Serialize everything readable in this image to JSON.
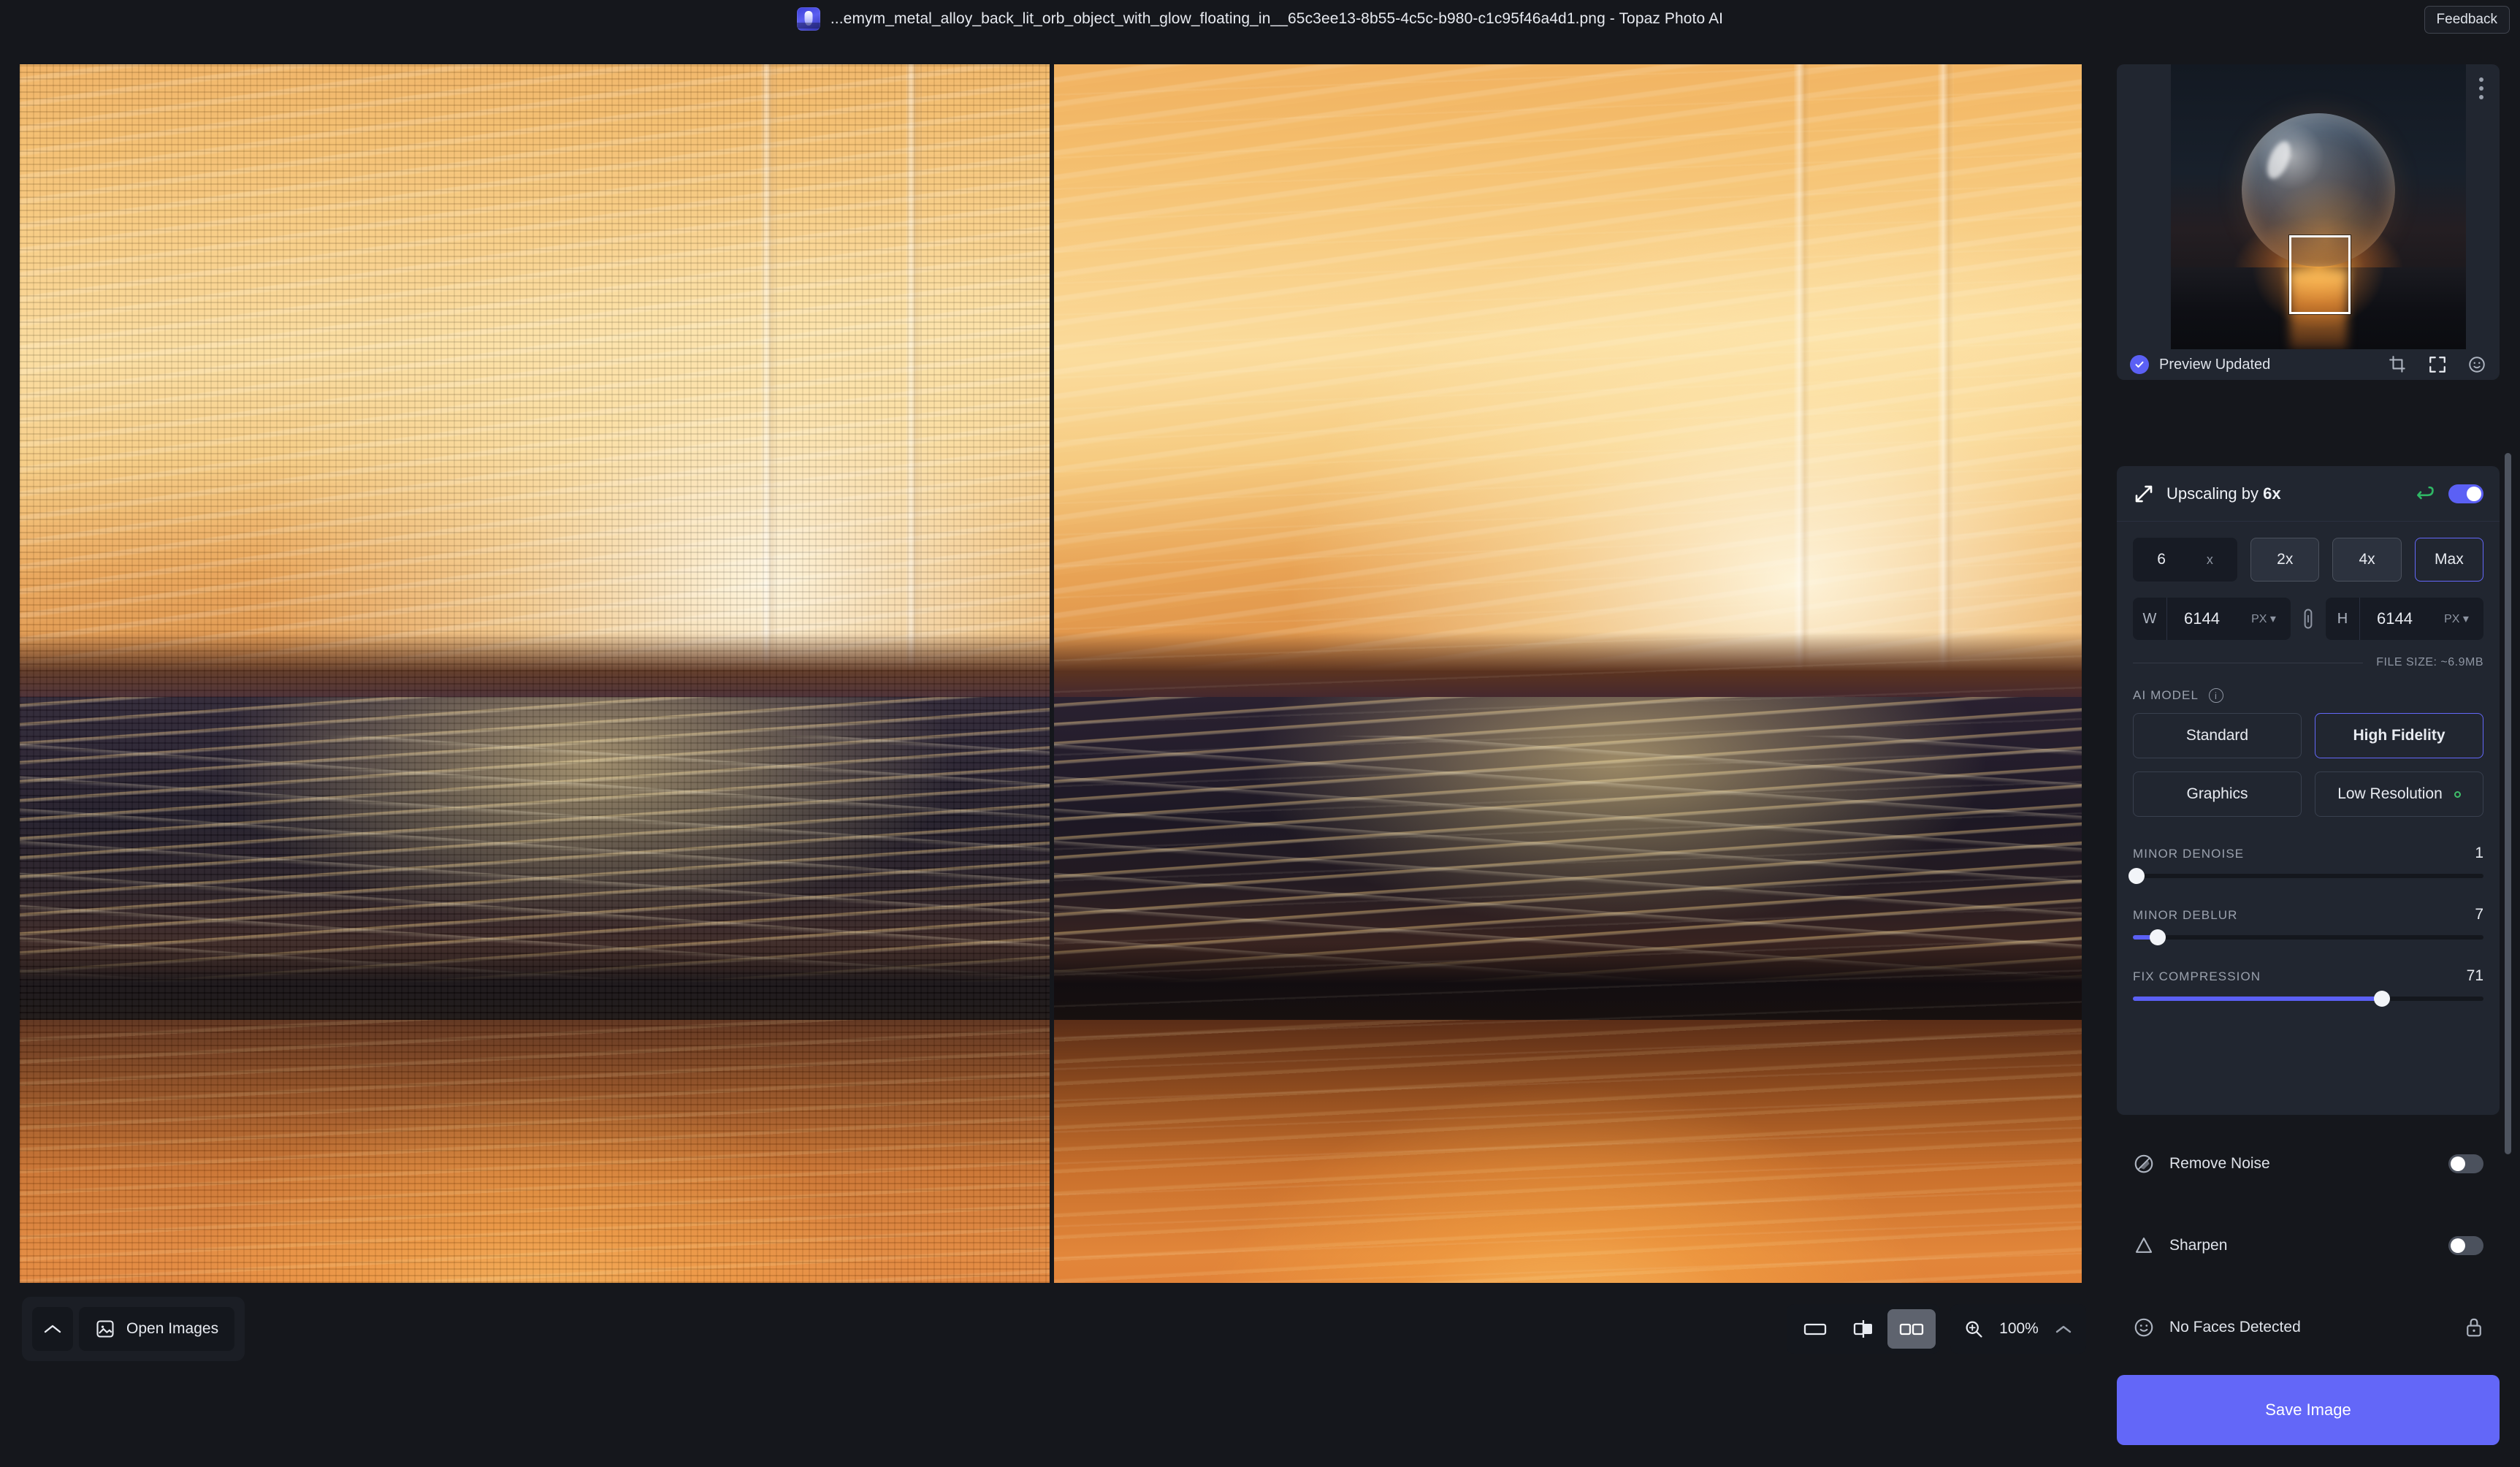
{
  "window": {
    "title": "...emym_metal_alloy_back_lit_orb_object_with_glow_floating_in__65c3ee13-8b55-4c5c-b980-c1c95f46a4d1.png - Topaz Photo AI",
    "feedback_label": "Feedback",
    "logo_icon": "topaz-photo-ai-logo"
  },
  "stage": {
    "before_pane_name": "original-image-pane",
    "after_pane_name": "processed-image-pane"
  },
  "bottom_bar": {
    "collapse_icon": "chevron-up-icon",
    "open_images_label": "Open Images",
    "open_images_icon": "image-icon",
    "view_modes": [
      {
        "name": "single-view",
        "icon": "rectangle-icon",
        "active": false
      },
      {
        "name": "split-view",
        "icon": "split-compare-icon",
        "active": false
      },
      {
        "name": "side-by-side-view",
        "icon": "two-panes-icon",
        "active": true
      }
    ],
    "zoom_icon": "magnifier-plus-icon",
    "zoom_value": "100%",
    "zoom_expand_icon": "chevron-up-icon"
  },
  "sidebar": {
    "preview": {
      "kebab_icon": "more-options-icon",
      "status_label": "Preview Updated",
      "status_icon": "check-circle-icon",
      "actions": [
        {
          "name": "crop-tool",
          "icon": "crop-icon"
        },
        {
          "name": "fullscreen-tool",
          "icon": "expand-icon"
        },
        {
          "name": "face-tool",
          "icon": "smiley-icon"
        }
      ]
    },
    "upscale": {
      "icon": "resize-arrows-icon",
      "title_prefix": "Upscaling by ",
      "title_value": "6x",
      "reset_icon": "undo-arrow-icon",
      "enabled": true,
      "scale_value": "6",
      "scale_unit": "x",
      "scale_presets": [
        {
          "label": "2x",
          "selected": false
        },
        {
          "label": "4x",
          "selected": false
        },
        {
          "label": "Max",
          "selected": true
        }
      ],
      "width_key": "W",
      "width_value": "6144",
      "width_unit": "PX",
      "link_icon": "link-icon",
      "height_key": "H",
      "height_value": "6144",
      "height_unit": "PX",
      "file_size": "FILE SIZE: ~6.9MB",
      "ai_model_label": "AI MODEL",
      "ai_model_info_icon": "info-icon",
      "models": [
        {
          "label": "Standard",
          "selected": false,
          "dot": false
        },
        {
          "label": "High Fidelity",
          "selected": true,
          "dot": false
        },
        {
          "label": "Graphics",
          "selected": false,
          "dot": false
        },
        {
          "label": "Low Resolution",
          "selected": false,
          "dot": true
        }
      ],
      "sliders": [
        {
          "name": "MINOR DENOISE",
          "value": "1",
          "percent": 1
        },
        {
          "name": "MINOR DEBLUR",
          "value": "7",
          "percent": 7
        },
        {
          "name": "FIX COMPRESSION",
          "value": "71",
          "percent": 71
        }
      ]
    },
    "filters": [
      {
        "name": "remove-noise",
        "icon": "noise-circle-icon",
        "label": "Remove Noise",
        "toggle": "off"
      },
      {
        "name": "sharpen",
        "icon": "triangle-icon",
        "label": "Sharpen",
        "toggle": "off"
      },
      {
        "name": "faces",
        "icon": "smiley-icon",
        "label": "No Faces Detected",
        "toggle": "locked",
        "lock_icon": "lock-icon"
      }
    ],
    "save_label": "Save Image"
  },
  "colors": {
    "accent": "#6367f8",
    "panel": "#212630",
    "background": "#15171c",
    "green": "#3fbf6a"
  }
}
